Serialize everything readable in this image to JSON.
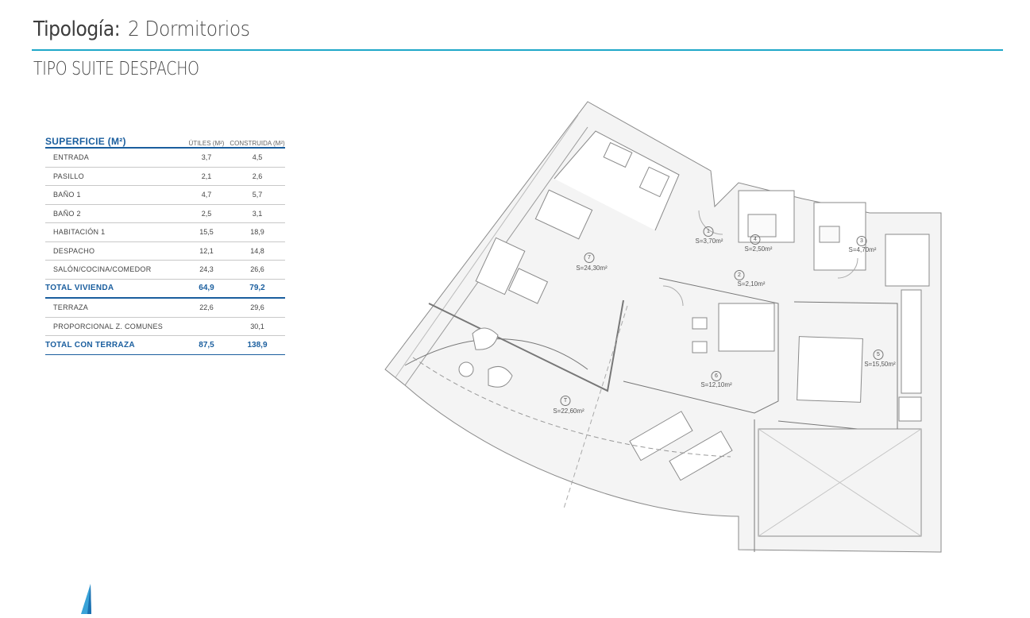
{
  "header": {
    "title_label": "Tipología:",
    "title_value": "2 Dormitorios",
    "subtitle": "TIPO SUITE DESPACHO"
  },
  "table": {
    "heading": "SUPERFICIE (M²)",
    "col_util": "ÚTILES (M²)",
    "col_const": "CONSTRUIDA (M²)",
    "rows": [
      {
        "name": "ENTRADA",
        "util": "3,7",
        "const": "4,5"
      },
      {
        "name": "PASILLO",
        "util": "2,1",
        "const": "2,6"
      },
      {
        "name": "BAÑO 1",
        "util": "4,7",
        "const": "5,7"
      },
      {
        "name": "BAÑO 2",
        "util": "2,5",
        "const": "3,1"
      },
      {
        "name": "HABITACIÓN 1",
        "util": "15,5",
        "const": "18,9"
      },
      {
        "name": "DESPACHO",
        "util": "12,1",
        "const": "14,8"
      },
      {
        "name": "SALÓN/COCINA/COMEDOR",
        "util": "24,3",
        "const": "26,6"
      }
    ],
    "total_vivienda": {
      "name": "TOTAL VIVIENDA",
      "util": "64,9",
      "const": "79,2"
    },
    "extra_rows": [
      {
        "name": "TERRAZA",
        "util": "22,6",
        "const": "29,6"
      },
      {
        "name": "PROPORCIONAL Z. COMUNES",
        "util": "",
        "const": "30,1"
      }
    ],
    "total_terraza": {
      "name": "TOTAL CON TERRAZA",
      "util": "87,5",
      "const": "138,9"
    }
  },
  "plan": {
    "rooms": [
      {
        "num": "1",
        "area": "S=3,70m²"
      },
      {
        "num": "2",
        "area": "S=2,10m²"
      },
      {
        "num": "3",
        "area": "S=4,70m²"
      },
      {
        "num": "4",
        "area": "S=2,50m²"
      },
      {
        "num": "5",
        "area": "S=15,50m²"
      },
      {
        "num": "6",
        "area": "S=12,10m²"
      },
      {
        "num": "7",
        "area": "S=24,30m²"
      },
      {
        "num": "T",
        "area": "S=22,60m²"
      }
    ]
  },
  "colors": {
    "accent": "#1fa8c9",
    "table_blue": "#1a5e9e"
  }
}
